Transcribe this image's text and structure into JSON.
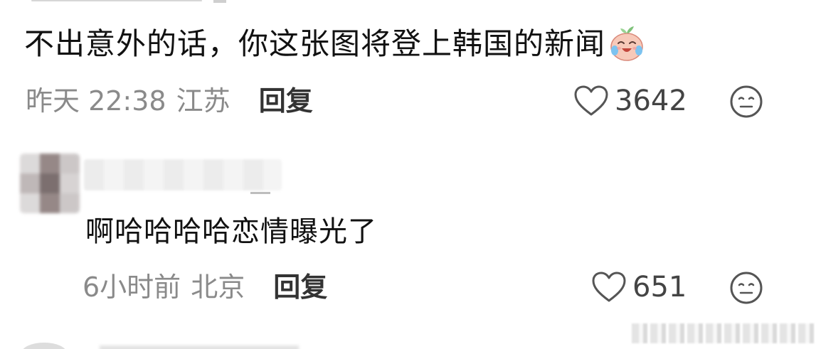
{
  "comments": [
    {
      "text": "不出意外的话，你这张图将登上韩国的新闻",
      "emoji": "crying-laughing-emoji",
      "time": "昨天 22:38",
      "location": "江苏",
      "reply_label": "回复",
      "likes": "3642",
      "icons": [
        "heart-icon",
        "neutral-face-icon"
      ]
    },
    {
      "text": "啊哈哈哈哈恋情曝光了",
      "time": "6小时前",
      "location": "北京",
      "reply_label": "回复",
      "likes": "651",
      "icons": [
        "heart-icon",
        "neutral-face-icon"
      ]
    }
  ],
  "colors": {
    "text_primary": "#111111",
    "text_meta": "#8a8a8a",
    "text_reply": "#333333",
    "icon_stroke": "#555555",
    "background": "#ffffff"
  }
}
